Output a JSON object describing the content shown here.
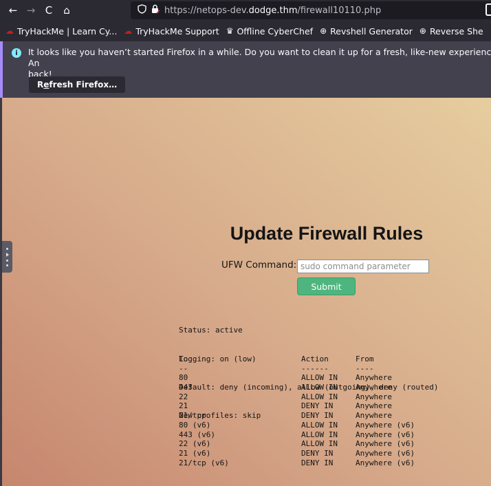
{
  "nav": {
    "back_icon": "←",
    "forward_icon": "→",
    "reload_icon": "C",
    "home_icon": "⌂",
    "url_scheme": "https://netops-dev.",
    "url_host": "dodge.thm",
    "url_path": "/firewall10110.php"
  },
  "bookmarks": [
    {
      "label": "TryHackMe | Learn Cy...",
      "icon": "thm-icon"
    },
    {
      "label": "TryHackMe Support",
      "icon": "thm-icon"
    },
    {
      "label": "Offline CyberChef",
      "icon": "chef-icon"
    },
    {
      "label": "Revshell Generator",
      "icon": "globe-icon"
    },
    {
      "label": "Reverse She",
      "icon": "globe-icon"
    }
  ],
  "notice": {
    "message": "It looks like you haven’t started Firefox in a while. Do you want to clean it up for a fresh, like-new experience? And by the way, welcome back!",
    "message_line1": "It looks like you haven’t started Firefox in a while. Do you want to clean it up for a fresh, like-new experience? An",
    "message_line2": "back!",
    "button_prefix": "R",
    "button_underlined": "e",
    "button_suffix": "fresh Firefox…"
  },
  "page": {
    "title": "Update Firewall Rules",
    "command_label": "UFW Command:",
    "command_placeholder": "sudo command parameter",
    "submit_label": "Submit"
  },
  "status": [
    "Status: active",
    "Logging: on (low)",
    "Default: deny (incoming), allow (outgoing), deny (routed)",
    "New profiles: skip"
  ],
  "rules_header": {
    "to": "To",
    "action": "Action",
    "from": "From"
  },
  "rules_separator": {
    "to": "--",
    "action": "------",
    "from": "----"
  },
  "rules": [
    {
      "to": "80",
      "action": "ALLOW IN",
      "from": "Anywhere"
    },
    {
      "to": "443",
      "action": "ALLOW IN",
      "from": "Anywhere"
    },
    {
      "to": "22",
      "action": "ALLOW IN",
      "from": "Anywhere"
    },
    {
      "to": "21",
      "action": "DENY IN",
      "from": "Anywhere"
    },
    {
      "to": "21/tcp",
      "action": "DENY IN",
      "from": "Anywhere"
    },
    {
      "to": "80 (v6)",
      "action": "ALLOW IN",
      "from": "Anywhere (v6)"
    },
    {
      "to": "443 (v6)",
      "action": "ALLOW IN",
      "from": "Anywhere (v6)"
    },
    {
      "to": "22 (v6)",
      "action": "ALLOW IN",
      "from": "Anywhere (v6)"
    },
    {
      "to": "21 (v6)",
      "action": "DENY IN",
      "from": "Anywhere (v6)"
    },
    {
      "to": "21/tcp (v6)",
      "action": "DENY IN",
      "from": "Anywhere (v6)"
    }
  ],
  "colors": {
    "submit_bg": "#4fb57f",
    "notice_accent": "#a78bfa",
    "thm_red": "#c41e1e"
  }
}
